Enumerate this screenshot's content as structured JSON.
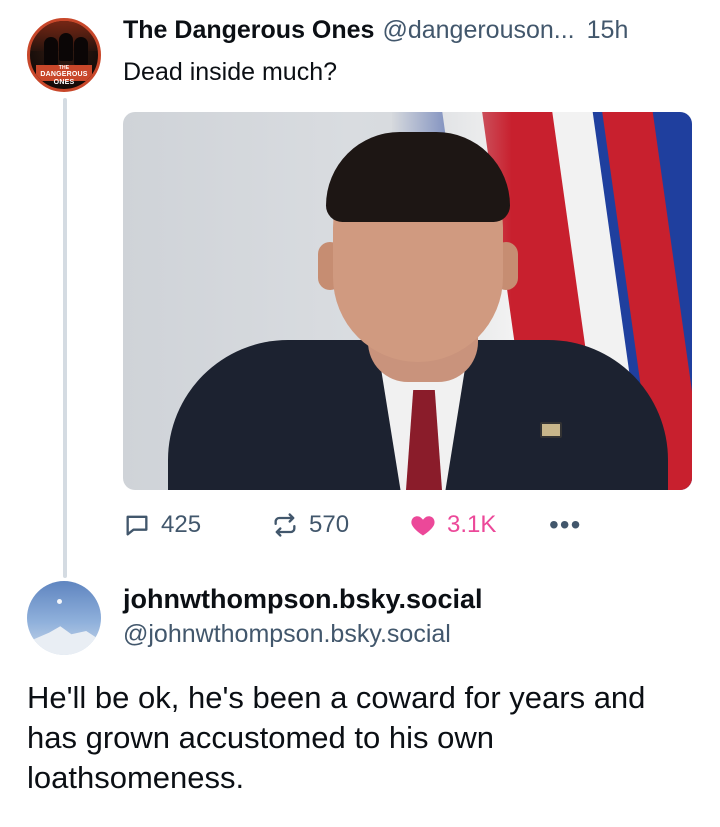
{
  "post1": {
    "author_name": "The Dangerous Ones",
    "author_handle": "@dangerouson...",
    "time": "15h",
    "text": "Dead inside much?",
    "avatar_text_small": "THE",
    "avatar_text": "DANGEROUS ONES",
    "stats": {
      "replies": "425",
      "reposts": "570",
      "likes": "3.1K"
    },
    "like_color": "#ec4899",
    "icons": [
      "reply-icon",
      "repost-icon",
      "heart-icon",
      "more-icon"
    ]
  },
  "post2": {
    "author_name": "johnwthompson.bsky.social",
    "author_handle": "@johnwthompson.bsky.social",
    "text": "He'll be ok, he's been a coward for years and has grown accustomed to his own loathsomeness."
  },
  "colors": {
    "secondary_text": "#42576c",
    "thread_line": "#d4dbe2",
    "accent_orange": "#c8472a"
  }
}
